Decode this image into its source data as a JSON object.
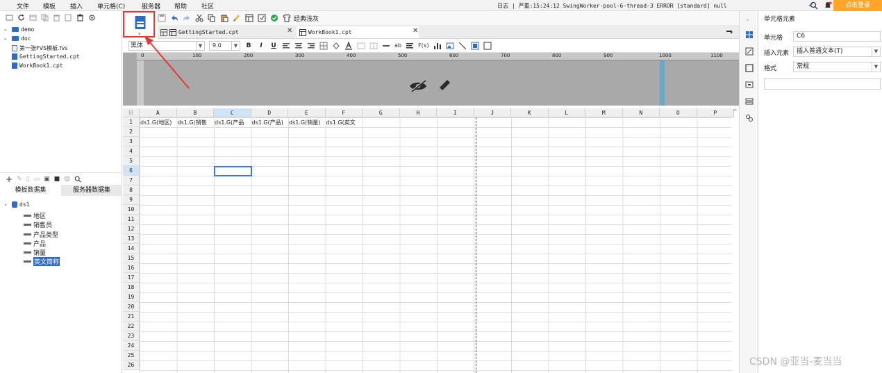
{
  "menubar": {
    "items": [
      "文件",
      "模板",
      "插入",
      "单元格(C)",
      "服务器",
      "帮助",
      "社区"
    ],
    "log_text": "日志 | 严重:15:24:12 SwingWorker-pool-6-thread-3 ERROR [standard] null",
    "login_button": "点击登录",
    "accent_color": "#ffa52a"
  },
  "file_tree": {
    "items": [
      "demo",
      "doc",
      "第一张FVS模板.fvs",
      "GettingStarted.cpt",
      "WorkBook1.cpt"
    ]
  },
  "dataset_panel": {
    "tabs": [
      "模板数据集",
      "服务器数据集"
    ],
    "dataset_name": "ds1",
    "fields": [
      "地区",
      "销售员",
      "产品类型",
      "产品",
      "销量",
      "英文简称"
    ]
  },
  "toolbar": {
    "classic_label": "经典浅灰"
  },
  "tabs": [
    {
      "label": "GettingStarted.cpt"
    },
    {
      "label": "WorkBook1.cpt"
    }
  ],
  "format_bar": {
    "font": "黑体",
    "size": "9.0",
    "bold": "B",
    "italic": "I",
    "underline": "U"
  },
  "ruler": {
    "labels": [
      "0",
      "100",
      "200",
      "300",
      "400",
      "500",
      "600",
      "700",
      "800",
      "900",
      "1000",
      "1100"
    ]
  },
  "grid": {
    "columns": [
      "A",
      "B",
      "C",
      "D",
      "E",
      "F",
      "G",
      "H",
      "I",
      "J",
      "K",
      "L",
      "M",
      "N",
      "O",
      "P"
    ],
    "rows": [
      "1",
      "2",
      "3",
      "4",
      "5",
      "6",
      "7",
      "8",
      "9",
      "10",
      "11",
      "12",
      "13",
      "14",
      "15",
      "16",
      "17",
      "18",
      "19",
      "20",
      "21",
      "22",
      "23",
      "24",
      "25",
      "26"
    ],
    "row1_cells": [
      "ds1.G(地区)",
      "ds1.G(销售",
      "ds1.G(产品",
      "ds1.G(产品)",
      "ds1.G(销量)",
      "ds1.G(英文"
    ],
    "selected_cell": "C6"
  },
  "properties": {
    "title": "单元格元素",
    "cell_label": "单元格",
    "cell_value": "C6",
    "insert_label": "插入元素",
    "insert_value": "插入普通文本(T)",
    "format_label": "格式",
    "format_value": "常规"
  },
  "watermark": "CSDN @亚当-麦当当",
  "colors": {
    "highlight_red": "#e53935",
    "selection_blue": "#3b7bd3",
    "icon_blue": "#2d6bc6"
  }
}
